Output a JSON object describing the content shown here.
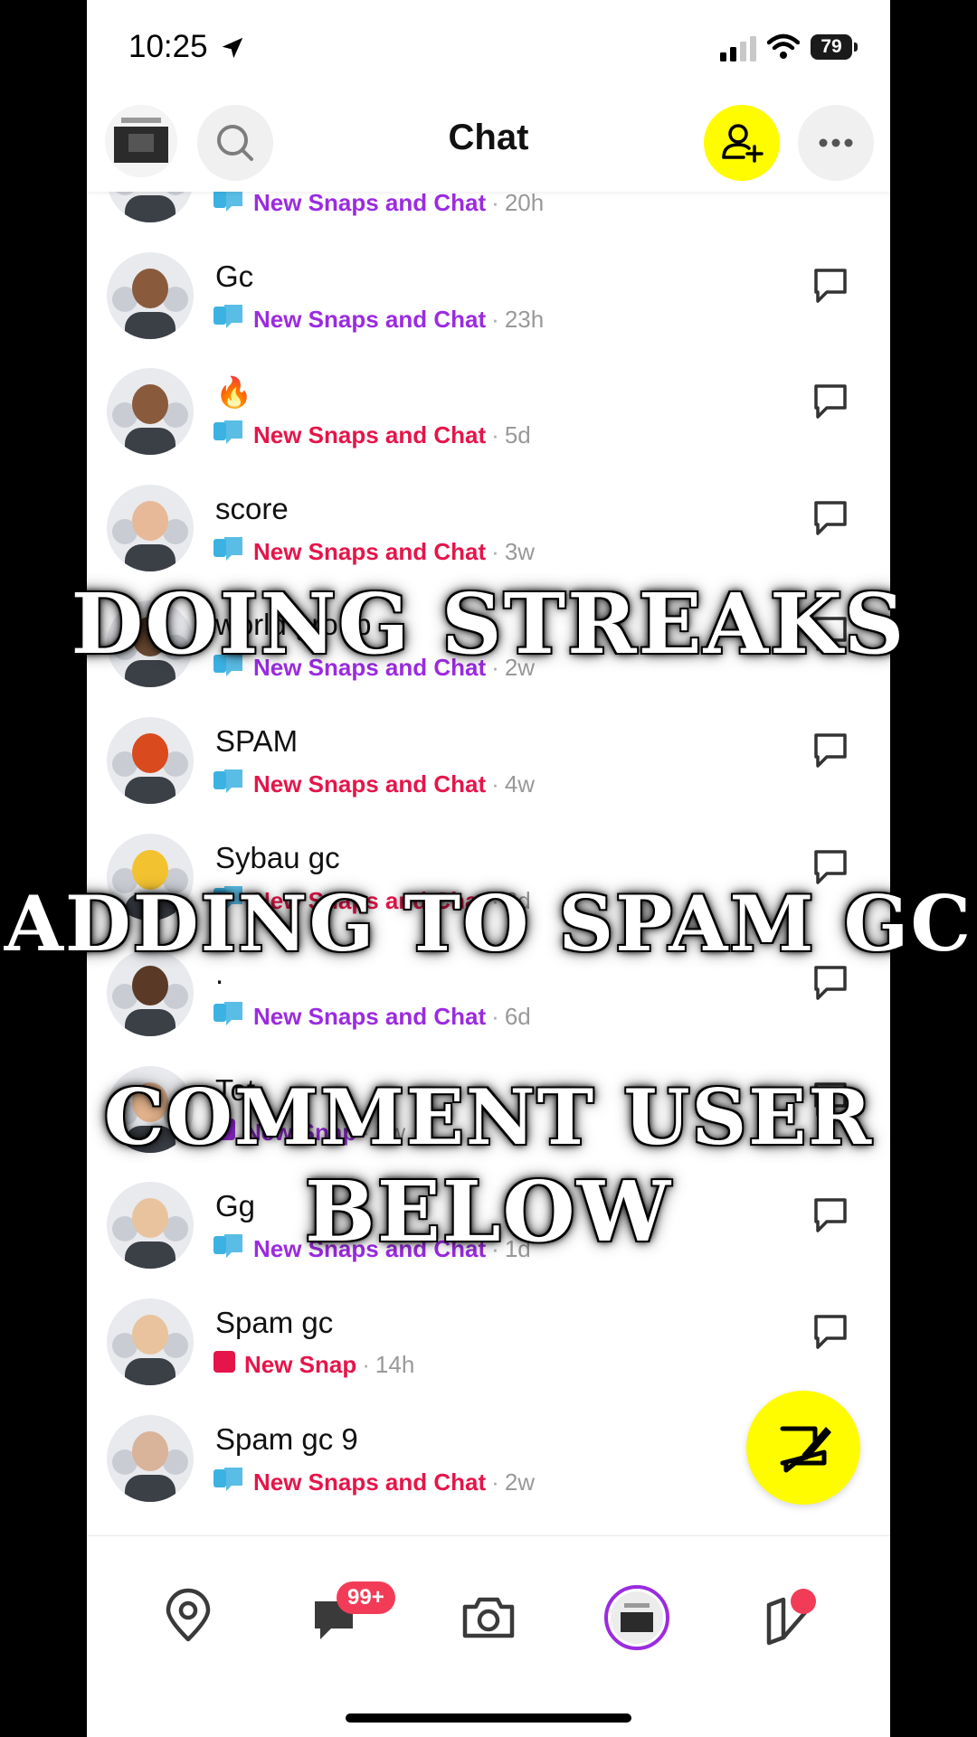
{
  "status_bar": {
    "time": "10:25",
    "battery": "79"
  },
  "header": {
    "title": "Chat"
  },
  "rows": [
    {
      "name": "",
      "status": "New Snaps and Chat",
      "status_color": "#9B2BE0",
      "time": "20h",
      "icon": "chat-bubble-icon"
    },
    {
      "name": "Gc",
      "status": "New Snaps and Chat",
      "status_color": "#9B2BE0",
      "time": "23h",
      "icon": "chat-bubble-icon"
    },
    {
      "name": "🔥",
      "status": "New Snaps and Chat",
      "status_color": "#E5154A",
      "time": "5d",
      "icon": "chat-bubble-icon"
    },
    {
      "name": "score",
      "status": "New Snaps and Chat",
      "status_color": "#E5154A",
      "time": "3w",
      "icon": "chat-bubble-icon"
    },
    {
      "name": "world group",
      "status": "New Snaps and Chat",
      "status_color": "#9B2BE0",
      "time": "2w",
      "icon": "chat-bubble-icon"
    },
    {
      "name": "SPAM",
      "status": "New Snaps and Chat",
      "status_color": "#E5154A",
      "time": "4w",
      "icon": "chat-bubble-icon"
    },
    {
      "name": "Sybau gc",
      "status": "New Snaps and Chat",
      "status_color": "#E5154A",
      "time": "6d",
      "icon": "chat-bubble-icon"
    },
    {
      "name": ".",
      "status": "New Snaps and Chat",
      "status_color": "#9B2BE0",
      "time": "6d",
      "icon": "chat-bubble-icon"
    },
    {
      "name": "Tot",
      "status": "New Snap",
      "status_color": "#9B2BE0",
      "time": "3w",
      "icon": "snap-square-icon"
    },
    {
      "name": "Gg",
      "status": "New Snaps and Chat",
      "status_color": "#9B2BE0",
      "time": "1d",
      "icon": "chat-bubble-icon"
    },
    {
      "name": "Spam gc",
      "status": "New Snap",
      "status_color": "#E5154A",
      "time": "14h",
      "icon": "snap-square-icon"
    },
    {
      "name": "Spam gc 9",
      "status": "New Snaps and Chat",
      "status_color": "#E5154A",
      "time": "2w",
      "icon": "chat-bubble-icon"
    }
  ],
  "overlay": {
    "line1": "DOING STREAKS",
    "line2": "ADDING TO SPAM GC",
    "line3": "COMMENT USER",
    "line4": "BELOW"
  },
  "bottom_nav": {
    "chat_badge": "99+"
  },
  "colors": {
    "snap_yellow": "#FFFC00",
    "purple": "#9B2BE0",
    "red": "#E5154A",
    "chat_blue": "#3CB2E2"
  }
}
